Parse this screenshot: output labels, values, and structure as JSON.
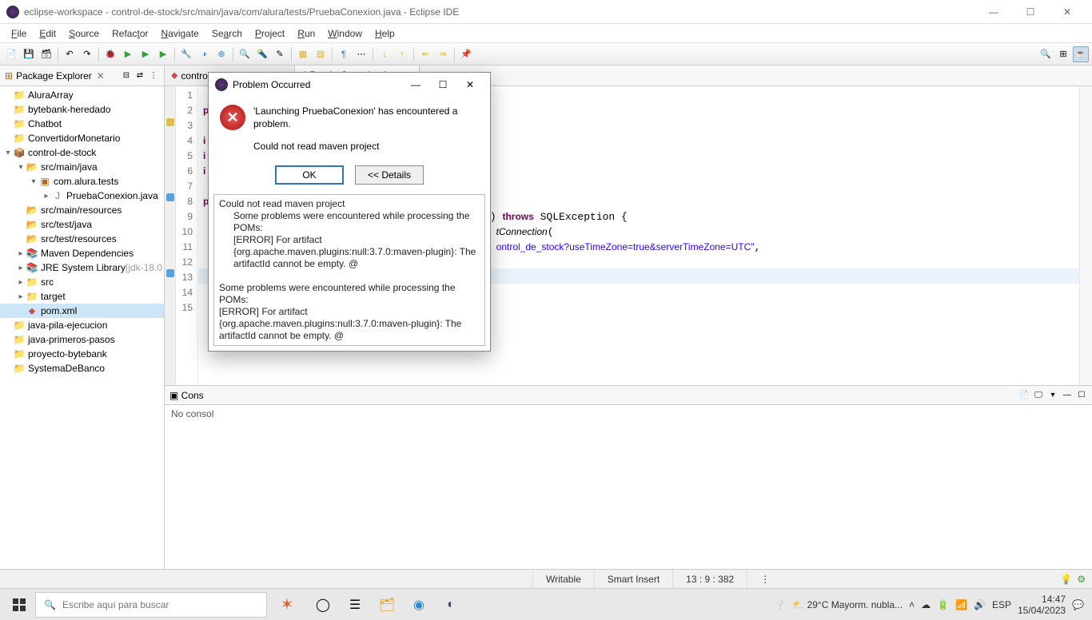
{
  "titlebar": {
    "text": "eclipse-workspace - control-de-stock/src/main/java/com/alura/tests/PruebaConexion.java - Eclipse IDE"
  },
  "menu": {
    "file": "File",
    "edit": "Edit",
    "source": "Source",
    "refactor": "Refactor",
    "navigate": "Navigate",
    "search": "Search",
    "project": "Project",
    "run": "Run",
    "window": "Window",
    "help": "Help"
  },
  "package_explorer": {
    "title": "Package Explorer",
    "items": [
      {
        "label": "AluraArray",
        "depth": 0,
        "icon": "proj"
      },
      {
        "label": "bytebank-heredado",
        "depth": 0,
        "icon": "proj"
      },
      {
        "label": "Chatbot",
        "depth": 0,
        "icon": "proj"
      },
      {
        "label": "ConvertidorMonetario",
        "depth": 0,
        "icon": "proj"
      },
      {
        "label": "control-de-stock",
        "depth": 0,
        "icon": "mvn",
        "toggle": "▾"
      },
      {
        "label": "src/main/java",
        "depth": 1,
        "icon": "src",
        "toggle": "▾"
      },
      {
        "label": "com.alura.tests",
        "depth": 2,
        "icon": "pkg",
        "toggle": "▾"
      },
      {
        "label": "PruebaConexion.java",
        "depth": 3,
        "icon": "java",
        "toggle": "▸"
      },
      {
        "label": "src/main/resources",
        "depth": 1,
        "icon": "src"
      },
      {
        "label": "src/test/java",
        "depth": 1,
        "icon": "src"
      },
      {
        "label": "src/test/resources",
        "depth": 1,
        "icon": "src"
      },
      {
        "label": "Maven Dependencies",
        "depth": 1,
        "icon": "jar",
        "toggle": "▸"
      },
      {
        "label": "JRE System Library",
        "depth": 1,
        "icon": "jar",
        "toggle": "▸",
        "suffix": "[jdk-18.0"
      },
      {
        "label": "src",
        "depth": 1,
        "icon": "folder",
        "toggle": "▸"
      },
      {
        "label": "target",
        "depth": 1,
        "icon": "folder",
        "toggle": "▸"
      },
      {
        "label": "pom.xml",
        "depth": 1,
        "icon": "xml",
        "selected": true
      },
      {
        "label": "java-pila-ejecucion",
        "depth": 0,
        "icon": "proj"
      },
      {
        "label": "java-primeros-pasos",
        "depth": 0,
        "icon": "proj"
      },
      {
        "label": "proyecto-bytebank",
        "depth": 0,
        "icon": "proj"
      },
      {
        "label": "SystemaDeBanco",
        "depth": 0,
        "icon": "proj"
      }
    ]
  },
  "editor": {
    "tabs": [
      {
        "label": "control-de-stock/pom.xml",
        "icon": "xml"
      },
      {
        "label": "PruebaConexion.java",
        "icon": "java",
        "active": true
      }
    ],
    "visible_lines": {
      "start": 1,
      "end": 15,
      "right_of_dialog": {
        "8": ") throws SQLException {",
        "9": "tConnection(",
        "10": "ontrol_de_stock?useTimeZone=true&serverTimeZone=UTC\","
      }
    }
  },
  "console": {
    "tab_label": "Cons",
    "body_text": "No consol"
  },
  "dialog": {
    "title": "Problem Occurred",
    "message": "'Launching PruebaConexion' has encountered a problem.",
    "submessage": "Could not read maven project",
    "ok": "OK",
    "details": "<< Details",
    "details_text": [
      "Could not read maven project",
      "    Some problems were encountered while processing the POMs:",
      "    [ERROR] For artifact {org.apache.maven.plugins:null:3.7.0:maven-plugin}: The artifactId cannot be empty. @",
      "",
      "Some problems were encountered while processing the POMs:",
      "[ERROR] For artifact {org.apache.maven.plugins:null:3.7.0:maven-plugin}: The artifactId cannot be empty. @"
    ]
  },
  "status": {
    "writable": "Writable",
    "insert": "Smart Insert",
    "pos": "13 : 9 : 382"
  },
  "taskbar": {
    "search_placeholder": "Escribe aquí para buscar",
    "weather": "29°C  Mayorm. nubla...",
    "lang": "ESP",
    "time": "14:47",
    "date": "15/04/2023"
  }
}
